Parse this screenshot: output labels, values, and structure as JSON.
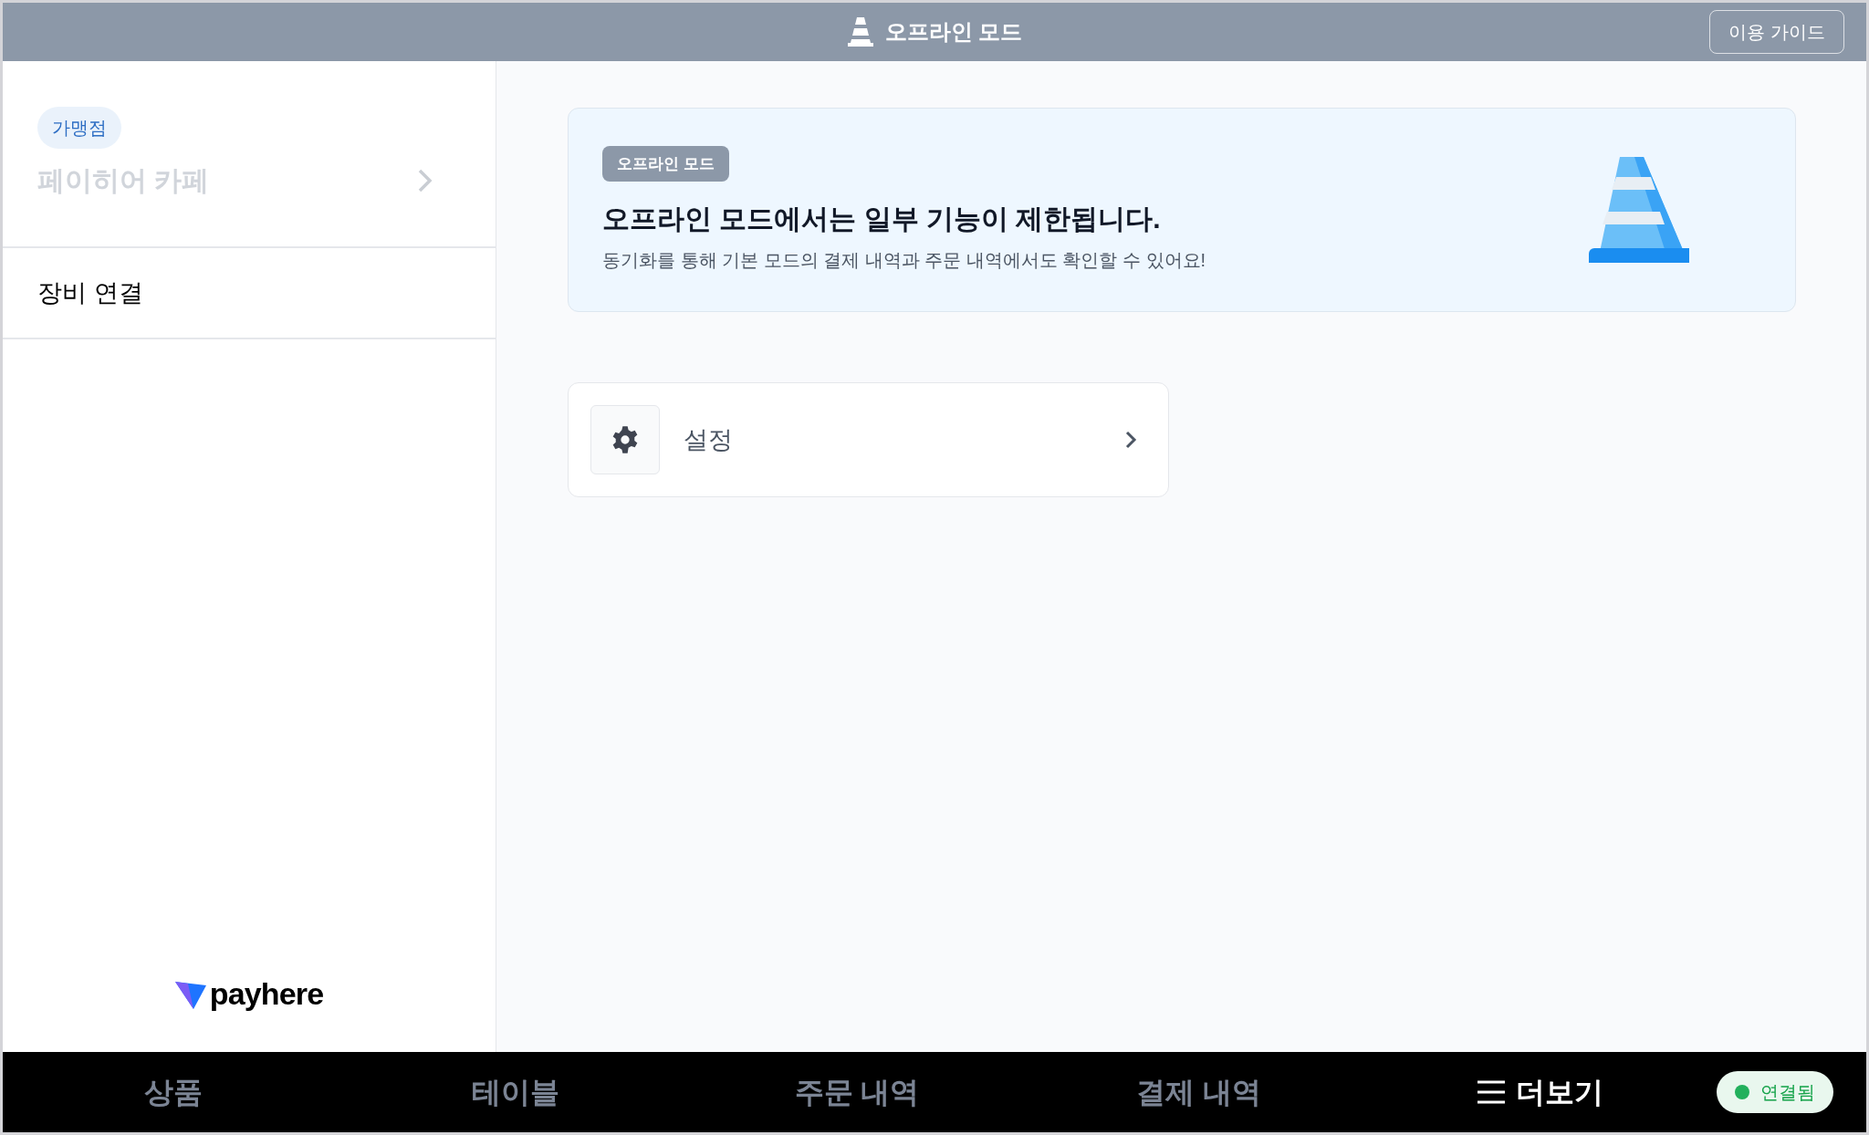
{
  "header": {
    "title": "오프라인 모드",
    "guide_button": "이용 가이드"
  },
  "sidebar": {
    "store_badge": "가맹점",
    "store_name": "페이히어 카페",
    "menu": [
      {
        "label": "장비 연결"
      }
    ],
    "logo_text": "payhere"
  },
  "banner": {
    "badge": "오프라인 모드",
    "title": "오프라인 모드에서는 일부 기능이 제한됩니다.",
    "subtitle": "동기화를 통해 기본 모드의 결제 내역과 주문 내역에서도 확인할 수 있어요!"
  },
  "menu_cards": [
    {
      "label": "설정"
    }
  ],
  "bottom_nav": {
    "items": [
      {
        "label": "상품",
        "kind": "tab",
        "selected": false
      },
      {
        "label": "테이블",
        "kind": "tab",
        "selected": false
      },
      {
        "label": "주문 내역",
        "kind": "tab",
        "selected": false
      },
      {
        "label": "결제 내역",
        "kind": "tab",
        "selected": false
      },
      {
        "label": "더보기",
        "kind": "menu",
        "selected": true
      }
    ],
    "connection": {
      "label": "연결됨",
      "connected": true
    }
  }
}
